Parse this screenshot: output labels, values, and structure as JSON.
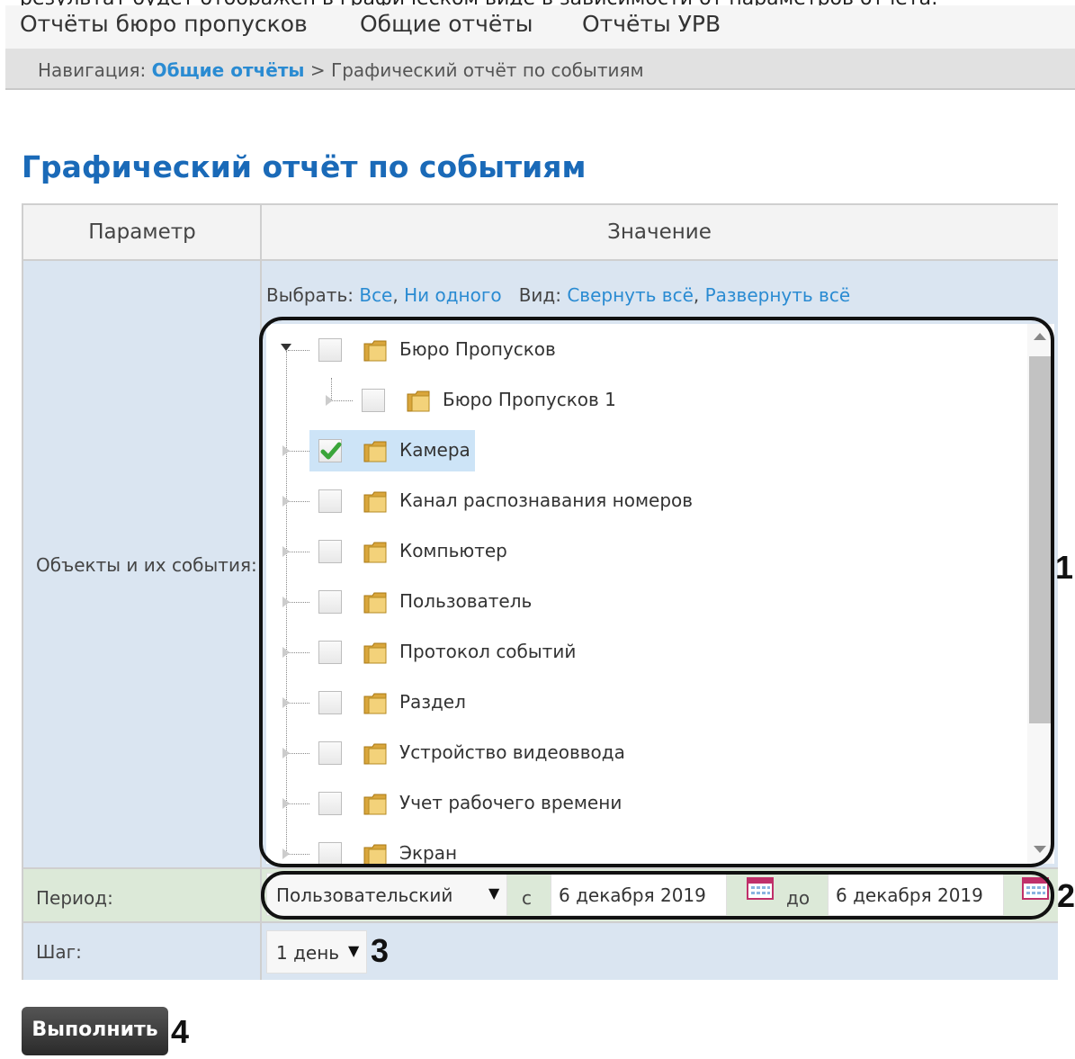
{
  "clipped_header_text": "результат будет отображён в графическом виде в зависимости от параметров отчёта:",
  "top_menu": [
    {
      "label": "Отчёты бюро пропусков"
    },
    {
      "label": "Общие отчёты"
    },
    {
      "label": "Отчёты УРВ"
    }
  ],
  "breadcrumb": {
    "prefix": "Навигация:",
    "link": "Общие отчёты",
    "separator": ">",
    "current": "Графический отчёт по событиям"
  },
  "page_title": "Графический отчёт по событиям",
  "table": {
    "header_param": "Параметр",
    "header_value": "Значение",
    "objects": {
      "label": "Объекты и их события:",
      "select_label": "Выбрать:",
      "select_all": "Все",
      "select_none": "Ни одного",
      "view_label": "Вид:",
      "collapse_all": "Свернуть всё",
      "expand_all": "Развернуть всё",
      "tree": [
        {
          "label": "Бюро Пропусков",
          "checked": false,
          "level": 0,
          "expanded": true
        },
        {
          "label": "Бюро Пропусков 1",
          "checked": false,
          "level": 1,
          "expanded": false
        },
        {
          "label": "Камера",
          "checked": true,
          "level": 0,
          "expanded": false,
          "selected": true
        },
        {
          "label": "Канал распознавания номеров",
          "checked": false,
          "level": 0,
          "expanded": false
        },
        {
          "label": "Компьютер",
          "checked": false,
          "level": 0,
          "expanded": false
        },
        {
          "label": "Пользователь",
          "checked": false,
          "level": 0,
          "expanded": false
        },
        {
          "label": "Протокол событий",
          "checked": false,
          "level": 0,
          "expanded": false
        },
        {
          "label": "Раздел",
          "checked": false,
          "level": 0,
          "expanded": false
        },
        {
          "label": "Устройство видеоввода",
          "checked": false,
          "level": 0,
          "expanded": false
        },
        {
          "label": "Учет рабочего времени",
          "checked": false,
          "level": 0,
          "expanded": false
        },
        {
          "label": "Экран",
          "checked": false,
          "level": 0,
          "expanded": false
        }
      ]
    },
    "period": {
      "label": "Период:",
      "mode": "Пользовательский",
      "from_label": "с",
      "from_date": "6 декабря 2019",
      "to_label": "до",
      "to_date": "6 декабря 2019"
    },
    "step": {
      "label": "Шаг:",
      "value": "1 день"
    }
  },
  "run_button": "Выполнить",
  "annotations": [
    "1",
    "2",
    "3",
    "4"
  ],
  "colors": {
    "accent": "#2a8bd2",
    "title": "#1a6ab8",
    "row_bg": "#dae5f1",
    "selected_row": "#cde4f7",
    "check": "#3aa53a"
  }
}
